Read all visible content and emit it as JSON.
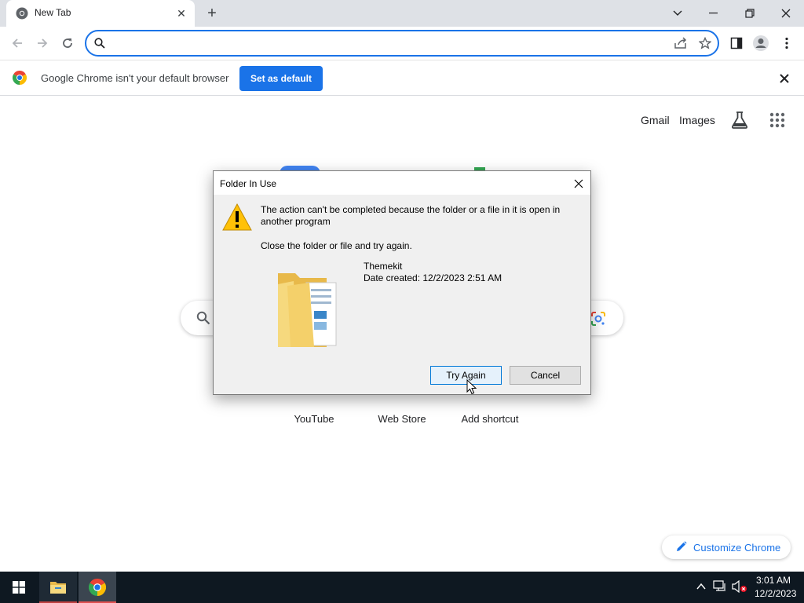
{
  "browser": {
    "tab_title": "New Tab",
    "omnibox_value": ""
  },
  "infobar": {
    "message": "Google Chrome isn't your default browser",
    "button_label": "Set as default"
  },
  "ntp": {
    "gmail_label": "Gmail",
    "images_label": "Images",
    "shortcuts": [
      {
        "label": "YouTube"
      },
      {
        "label": "Web Store"
      },
      {
        "label": "Add shortcut"
      }
    ],
    "customize_label": "Customize Chrome"
  },
  "dialog": {
    "title": "Folder In Use",
    "message": "The action can't be completed because the folder or a file in it is open in another program",
    "hint": "Close the folder or file and try again.",
    "item_name": "Themekit",
    "item_date": "Date created: 12/2/2023 2:51 AM",
    "try_again_label": "Try Again",
    "cancel_label": "Cancel"
  },
  "taskbar": {
    "time": "3:01 AM",
    "date": "12/2/2023"
  },
  "colors": {
    "accent": "#1a73e8",
    "tabstrip": "#dee1e6",
    "taskbar": "#0e1821",
    "dialog_bg": "#f0f0f0"
  }
}
